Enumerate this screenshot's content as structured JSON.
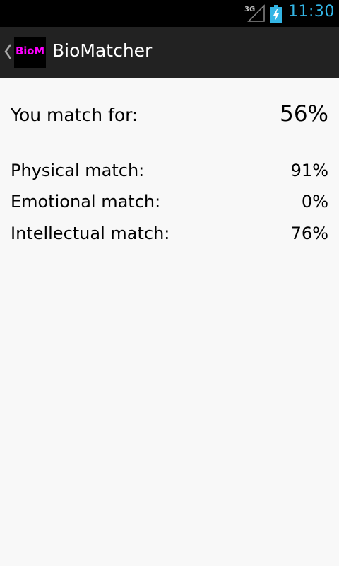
{
  "status_bar": {
    "network": "3G",
    "time": "11:30"
  },
  "action_bar": {
    "icon_text": "BioM",
    "title": "BioMatcher"
  },
  "main": {
    "total_label": "You match for:",
    "total_value": "56%",
    "matches": [
      {
        "label": "Physical match:",
        "value": "91%"
      },
      {
        "label": "Emotional match:",
        "value": "0%"
      },
      {
        "label": "Intellectual match:",
        "value": "76%"
      }
    ]
  },
  "colors": {
    "status_accent": "#33b5e5",
    "action_bar_bg": "#222222",
    "icon_text": "#ff00ff",
    "content_bg": "#f8f8f8"
  },
  "icons": [
    "signal-3g-icon",
    "battery-charging-icon",
    "back-chevron-icon",
    "app-icon"
  ]
}
